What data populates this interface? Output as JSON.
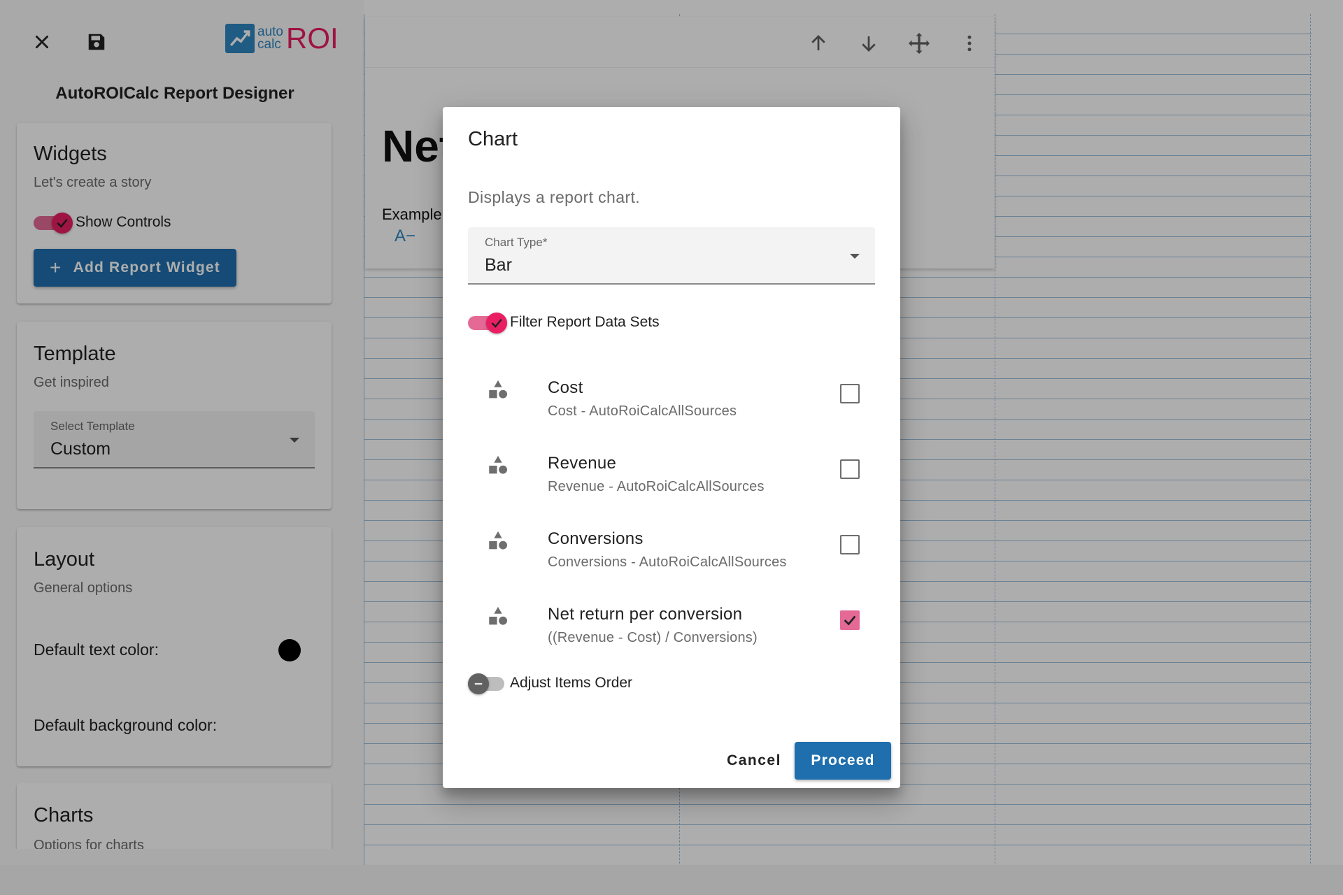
{
  "app": {
    "logo_small_top": "auto",
    "logo_small_bottom": "calc",
    "logo_big": "ROI",
    "title": "AutoROICalc Report Designer"
  },
  "widgets_card": {
    "title": "Widgets",
    "subtitle": "Let's create a story",
    "show_controls_label": "Show Controls",
    "show_controls_on": true,
    "add_button_icon": "+",
    "add_button_label": "Add Report Widget"
  },
  "template_card": {
    "title": "Template",
    "subtitle": "Get inspired",
    "select_label": "Select Template",
    "select_value": "Custom"
  },
  "layout_card": {
    "title": "Layout",
    "subtitle": "General options",
    "text_color_label": "Default text color:",
    "text_color": "#000000",
    "bg_color_label": "Default background color:"
  },
  "charts_card": {
    "title": "Charts",
    "subtitle": "Options for charts"
  },
  "canvas_widget": {
    "heading": "Net",
    "text": "Example",
    "font_decrease": "A−"
  },
  "icons": {
    "close": "close-icon",
    "save": "save-icon",
    "arrow_up": "arrow-up-icon",
    "arrow_down": "arrow-down-icon",
    "move": "move-icon",
    "more": "more-vertical-icon",
    "dataset": "shapes-icon",
    "dropdown": "chevron-down-icon"
  },
  "colors": {
    "primary": "#1f6fae",
    "accent": "#e91e63",
    "brand_blue": "#2e86c1"
  },
  "dialog": {
    "title": "Chart",
    "description": "Displays a report chart.",
    "chart_type_label": "Chart Type*",
    "chart_type_value": "Bar",
    "filter_label": "Filter Report Data Sets",
    "filter_on": true,
    "datasets": [
      {
        "name": "Cost",
        "source": "Cost - AutoRoiCalcAllSources",
        "checked": false
      },
      {
        "name": "Revenue",
        "source": "Revenue - AutoRoiCalcAllSources",
        "checked": false
      },
      {
        "name": "Conversions",
        "source": "Conversions - AutoRoiCalcAllSources",
        "checked": false
      },
      {
        "name": "Net return per conversion",
        "source": "((Revenue - Cost) / Conversions)",
        "checked": true
      }
    ],
    "adjust_order_label": "Adjust Items Order",
    "adjust_order_on": false,
    "cancel_label": "Cancel",
    "proceed_label": "Proceed"
  }
}
